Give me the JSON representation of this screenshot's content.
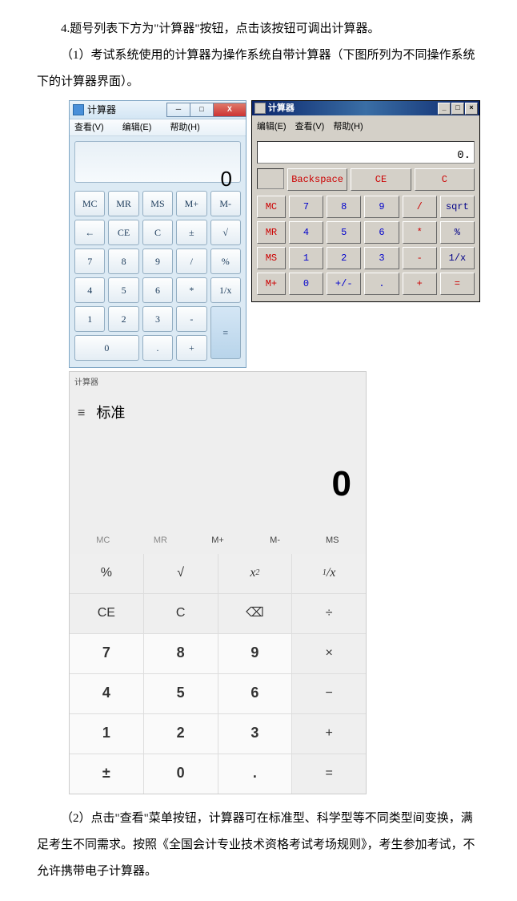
{
  "text": {
    "p1": "4.题号列表下方为\"计算器\"按钮，点击该按钮可调出计算器。",
    "p2": "（1）考试系统使用的计算器为操作系统自带计算器（下图所列为不同操作系统下的计算器界面）。",
    "p3": "（2）点击\"查看\"菜单按钮，计算器可在标准型、科学型等不同类型间变换，满足考生不同需求。按照《全国会计专业技术资格考试考场规则》，考生参加考试，不允许携带电子计算器。"
  },
  "w7": {
    "title": "计算器",
    "menu": [
      "查看(V)",
      "编辑(E)",
      "帮助(H)"
    ],
    "display": "0",
    "keys": [
      "MC",
      "MR",
      "MS",
      "M+",
      "M-",
      "←",
      "CE",
      "C",
      "±",
      "√",
      "7",
      "8",
      "9",
      "/",
      "%",
      "4",
      "5",
      "6",
      "*",
      "1/x",
      "1",
      "2",
      "3",
      "-",
      "=",
      "0",
      ".",
      "+"
    ]
  },
  "xp": {
    "title": "计算器",
    "menu": [
      "编辑(E)",
      "查看(V)",
      "帮助(H)"
    ],
    "display": "0.",
    "top": [
      "Backspace",
      "CE",
      "C"
    ],
    "rows": [
      [
        "MC",
        "7",
        "8",
        "9",
        "/",
        "sqrt"
      ],
      [
        "MR",
        "4",
        "5",
        "6",
        "*",
        "%"
      ],
      [
        "MS",
        "1",
        "2",
        "3",
        "-",
        "1/x"
      ],
      [
        "M+",
        "0",
        "+/-",
        ".",
        "+",
        "="
      ]
    ]
  },
  "w10": {
    "tb": "计算器",
    "mode": "标准",
    "display": "0",
    "mem": [
      "MC",
      "MR",
      "M+",
      "M-",
      "MS"
    ],
    "keys": [
      "%",
      "√",
      "x²",
      "¹/x",
      "CE",
      "C",
      "⌫",
      "÷",
      "7",
      "8",
      "9",
      "×",
      "4",
      "5",
      "6",
      "−",
      "1",
      "2",
      "3",
      "+",
      "±",
      "0",
      ".",
      "="
    ]
  }
}
